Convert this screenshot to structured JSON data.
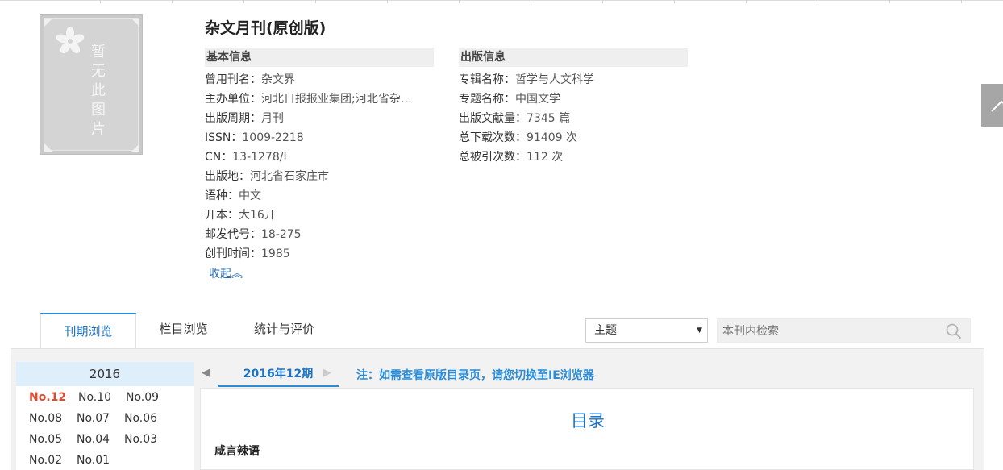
{
  "journal": {
    "title": "杂文月刊(原创版)",
    "cover_text": "暂无此图片"
  },
  "basic_info": {
    "heading": "基本信息",
    "items": [
      {
        "label": "曾用刊名：",
        "value": "杂文界"
      },
      {
        "label": "主办单位：",
        "value": "河北日报报业集团;河北省杂…"
      },
      {
        "label": "出版周期：",
        "value": "月刊"
      },
      {
        "label": "ISSN：",
        "value": "1009-2218"
      },
      {
        "label": "CN：",
        "value": "13-1278/I"
      },
      {
        "label": "出版地：",
        "value": "河北省石家庄市"
      },
      {
        "label": "语种：",
        "value": "中文"
      },
      {
        "label": "开本：",
        "value": "大16开"
      },
      {
        "label": "邮发代号：",
        "value": "18-275"
      },
      {
        "label": "创刊时间：",
        "value": "1985"
      }
    ],
    "collapse_label": "收起︽"
  },
  "publish_info": {
    "heading": "出版信息",
    "items": [
      {
        "label": "专辑名称：",
        "value": "哲学与人文科学"
      },
      {
        "label": "专题名称：",
        "value": "中国文学"
      },
      {
        "label": "出版文献量：",
        "value": "7345 篇"
      },
      {
        "label": "总下载次数：",
        "value": "91409 次"
      },
      {
        "label": "总被引次数：",
        "value": "112 次"
      }
    ]
  },
  "tabs": [
    {
      "label": "刊期浏览",
      "active": true
    },
    {
      "label": "栏目浏览",
      "active": false
    },
    {
      "label": "统计与评价",
      "active": false
    }
  ],
  "search": {
    "field_selected": "主题",
    "placeholder": "本刊内检索"
  },
  "years": {
    "year": "2016",
    "issues": [
      "No.12",
      "No.10",
      "No.09",
      "No.08",
      "No.07",
      "No.06",
      "No.05",
      "No.04",
      "No.03",
      "No.02",
      "No.01"
    ],
    "current_issue": "No.12"
  },
  "period": {
    "prev_symbol": "◀",
    "next_symbol": "▶",
    "current": "2016年12期",
    "note": "注：如需查看原版目录页，请您切换至IE浏览器"
  },
  "toc": {
    "title": "目录",
    "first_section": "咸言辣语"
  },
  "colors": {
    "accent": "#2a8bd6",
    "current_issue": "#e04a2f",
    "year_head_bg": "#dfeefb"
  }
}
